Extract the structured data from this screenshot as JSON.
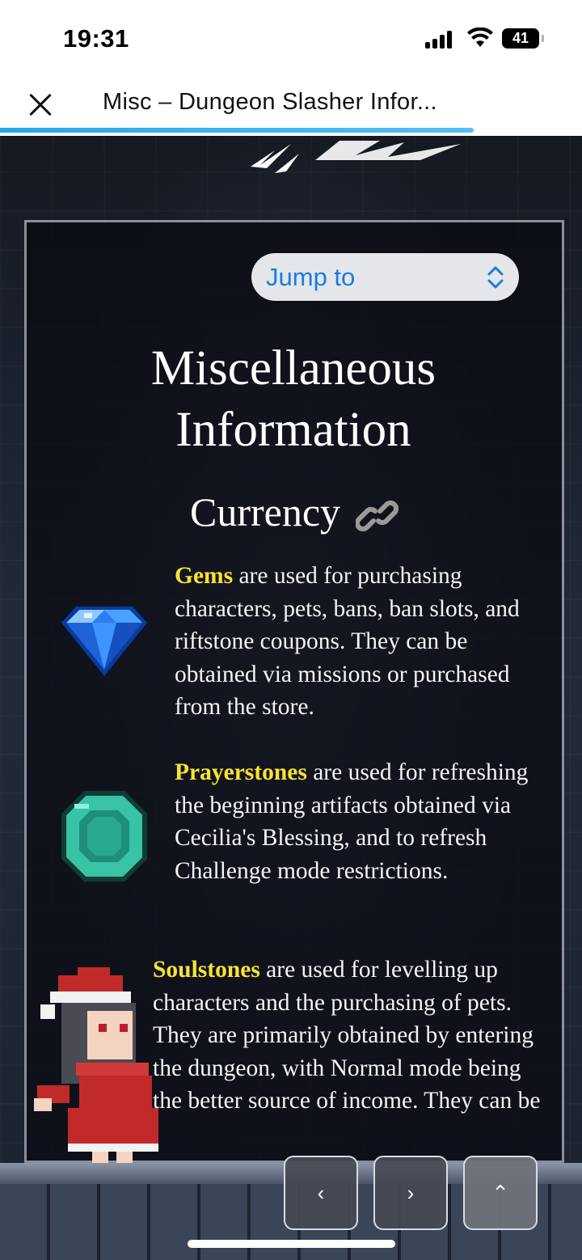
{
  "status_bar": {
    "time": "19:31",
    "battery": "41"
  },
  "browser": {
    "title": "Misc – Dungeon Slasher Infor..."
  },
  "jump_to": {
    "label": "Jump to"
  },
  "page": {
    "heading": "Miscellaneous Information",
    "section_title": "Currency",
    "items": [
      {
        "name": "Gems",
        "text": " are used for purchasing characters, pets, bans, ban slots, and riftstone coupons. They can be obtained via missions or purchased from the store."
      },
      {
        "name": "Prayerstones",
        "text": " are used for refreshing the beginning artifacts obtained via Cecilia's Blessing, and to refresh Challenge mode restrictions."
      },
      {
        "name": "Soulstones",
        "text": " are used for levelling up characters and the purchasing of pets. They are primarily obtained by entering the dungeon, with Normal mode being the better source of income. They can be"
      }
    ]
  },
  "bottom_nav": {
    "prev": "‹",
    "next": "›",
    "top": "⌃"
  },
  "colors": {
    "highlight": "#f8e332",
    "progress": "#27a7ea",
    "link_blue": "#1e7ae0"
  }
}
